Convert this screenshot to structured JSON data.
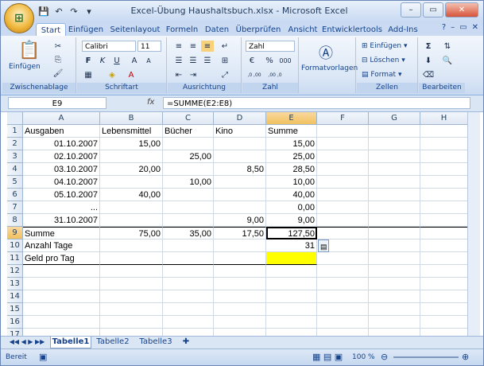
{
  "window": {
    "title": "Excel-Übung Haushaltsbuch.xlsx - Microsoft Excel",
    "min": "–",
    "max": "▭",
    "close": "✕"
  },
  "qat": {
    "save": "💾",
    "undo": "↶",
    "redo": "↷",
    "more": "▾"
  },
  "tabs": [
    "Start",
    "Einfügen",
    "Seitenlayout",
    "Formeln",
    "Daten",
    "Überprüfen",
    "Ansicht",
    "Entwicklertools",
    "Add-Ins"
  ],
  "ribbon": {
    "clipboard": {
      "label": "Zwischenablage",
      "paste": "Einfügen"
    },
    "font": {
      "label": "Schriftart",
      "name": "Calibri",
      "size": "11",
      "bold": "F",
      "italic": "K",
      "underline": "U",
      "grow": "A",
      "shrink": "A"
    },
    "alignment": {
      "label": "Ausrichtung"
    },
    "number": {
      "label": "Zahl",
      "format": "Zahl",
      "percent": "%",
      "thousands": "000",
      "inc": ",0 ,00",
      "dec": ",00 ,0"
    },
    "styles": {
      "label": "Formatvorlagen"
    },
    "cells": {
      "label": "Zellen",
      "insert": "Einfügen",
      "delete": "Löschen",
      "format": "Format"
    },
    "editing": {
      "label": "Bearbeiten",
      "sum": "Σ"
    }
  },
  "formula_bar": {
    "name_box": "E9",
    "fx": "fx",
    "formula": "=SUMME(E2:E8)"
  },
  "columns": [
    "A",
    "B",
    "C",
    "D",
    "E",
    "F",
    "G",
    "H"
  ],
  "rows": [
    "1",
    "2",
    "3",
    "4",
    "5",
    "6",
    "7",
    "8",
    "9",
    "10",
    "11",
    "12",
    "13",
    "14",
    "15",
    "16",
    "17"
  ],
  "cells": {
    "r1": [
      "Ausgaben",
      "Lebensmittel",
      "Bücher",
      "Kino",
      "Summe"
    ],
    "r2": [
      "01.10.2007",
      "15,00",
      "",
      "",
      "15,00"
    ],
    "r3": [
      "02.10.2007",
      "",
      "25,00",
      "",
      "25,00"
    ],
    "r4": [
      "03.10.2007",
      "20,00",
      "",
      "8,50",
      "28,50"
    ],
    "r5": [
      "04.10.2007",
      "",
      "10,00",
      "",
      "10,00"
    ],
    "r6": [
      "05.10.2007",
      "40,00",
      "",
      "",
      "40,00"
    ],
    "r7": [
      "...",
      "",
      "",
      "",
      "0,00"
    ],
    "r8": [
      "31.10.2007",
      "",
      "",
      "9,00",
      "9,00"
    ],
    "r9": [
      "Summe",
      "75,00",
      "35,00",
      "17,50",
      "127,50"
    ],
    "r10": [
      "Anzahl Tage",
      "",
      "",
      "",
      "31"
    ],
    "r11": [
      "Geld pro Tag",
      "",
      "",
      "",
      ""
    ]
  },
  "sheets": [
    "Tabelle1",
    "Tabelle2",
    "Tabelle3"
  ],
  "status": {
    "ready": "Bereit",
    "zoom": "100 %"
  },
  "colors": {
    "highlight": "#ffff00",
    "selected_header": "#f5c35f"
  }
}
